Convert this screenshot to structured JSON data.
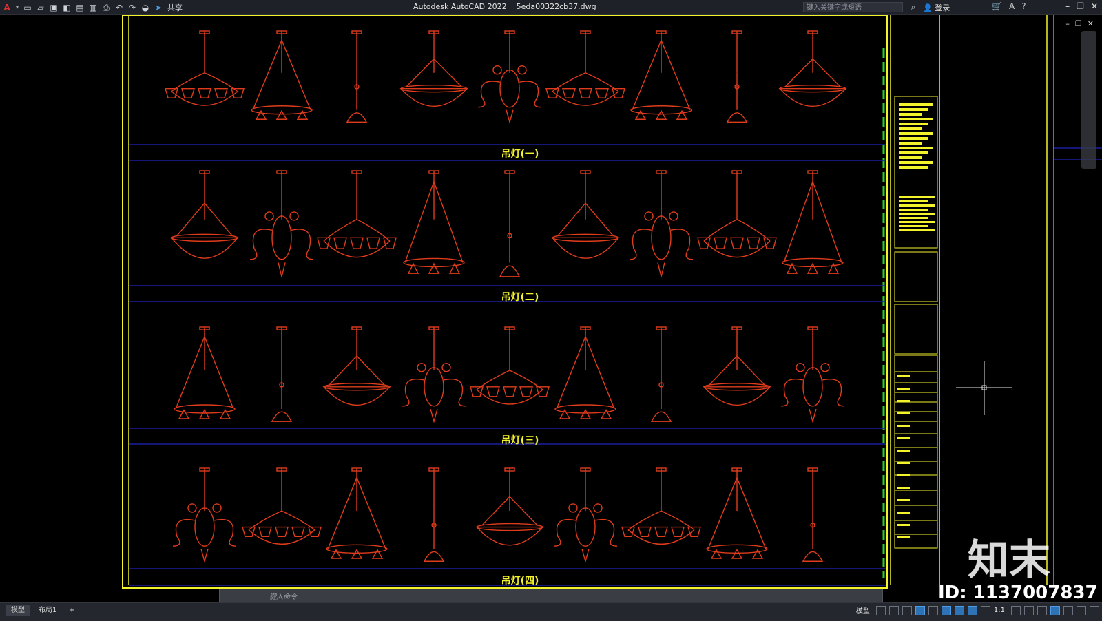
{
  "app": {
    "title": "Autodesk AutoCAD 2022",
    "file": "5eda00322cb37.dwg",
    "share_label": "共享",
    "search_placeholder": "键入关键字或短语",
    "login_label": "登录"
  },
  "drawing": {
    "row_labels": [
      "吊灯(一)",
      "吊灯(二)",
      "吊灯(三)",
      "吊灯(四)"
    ],
    "colors": {
      "fixture": "#e03c1c",
      "band": "#1a1ea0",
      "border": "#f3f32c",
      "title_text": "#f3f32c",
      "grid": "#24d424"
    }
  },
  "command": {
    "placeholder": "键入命令"
  },
  "status": {
    "tabs": [
      "模型",
      "布局1"
    ],
    "add_tab": "+",
    "model_label": "模型",
    "scale": "1:1"
  },
  "watermark": {
    "brand": "知末",
    "id": "ID: 1137007837"
  }
}
